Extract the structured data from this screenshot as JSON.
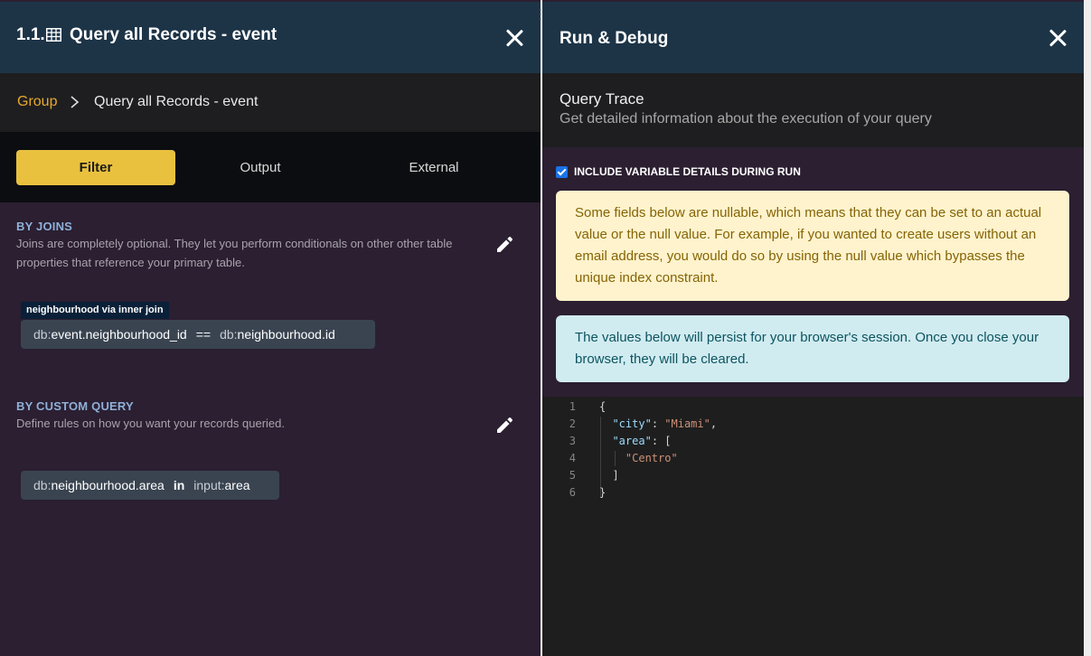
{
  "left": {
    "header": {
      "number": "1.1.",
      "title": "Query all Records - event",
      "table_icon": "table-icon",
      "close_icon": "close-icon"
    },
    "breadcrumb": {
      "group": "Group",
      "current": "Query all Records - event"
    },
    "tabs": [
      {
        "label": "Filter",
        "active": true
      },
      {
        "label": "Output"
      },
      {
        "label": "External"
      }
    ],
    "joins": {
      "heading": "BY JOINS",
      "description": "Joins are completely optional. They let you perform conditionals on other other table properties that reference your primary table.",
      "tag": "neighbourhood via inner join",
      "expr": {
        "lhs_prefix": "db:",
        "lhs": "event.neighbourhood_id",
        "op": "==",
        "rhs_prefix": "db:",
        "rhs": "neighbourhood.id"
      }
    },
    "custom": {
      "heading": "BY CUSTOM QUERY",
      "description": "Define rules on how you want your records queried.",
      "expr": {
        "lhs_prefix": "db:",
        "lhs": "neighbourhood.area",
        "op": "in",
        "rhs_prefix": "input:",
        "rhs": "area"
      }
    }
  },
  "right": {
    "header": {
      "title": "Run & Debug",
      "close_icon": "close-icon"
    },
    "trace": {
      "title": "Query Trace",
      "subtitle": "Get detailed information about the execution of your query"
    },
    "checkbox": {
      "label": "INCLUDE VARIABLE DETAILS DURING RUN",
      "checked": true
    },
    "warning": "Some fields below are nullable, which means that they can be set to an actual value or the null value. For example, if you wanted to create users without an email address, you would do so by using the null value which bypasses the unique index constraint.",
    "info": "The values below will persist for your browser's session. Once you close your browser, they will be cleared.",
    "editor": {
      "line_numbers": [
        "1",
        "2",
        "3",
        "4",
        "5",
        "6"
      ],
      "lines": [
        {
          "indent": "",
          "tokens": [
            {
              "t": "p",
              "v": "{"
            }
          ]
        },
        {
          "indent": "  ",
          "tokens": [
            {
              "t": "k",
              "v": "\"city\""
            },
            {
              "t": "p",
              "v": ": "
            },
            {
              "t": "s",
              "v": "\"Miami\""
            },
            {
              "t": "p",
              "v": ","
            }
          ]
        },
        {
          "indent": "  ",
          "tokens": [
            {
              "t": "k",
              "v": "\"area\""
            },
            {
              "t": "p",
              "v": ": ["
            }
          ]
        },
        {
          "indent": "    ",
          "tokens": [
            {
              "t": "s",
              "v": "\"Centro\""
            }
          ]
        },
        {
          "indent": "  ",
          "tokens": [
            {
              "t": "p",
              "v": "]"
            }
          ]
        },
        {
          "indent": "",
          "tokens": [
            {
              "t": "p",
              "v": "}"
            }
          ]
        }
      ]
    }
  },
  "colors": {
    "accent": "#e9c13f",
    "header_bg": "#1d3447",
    "panel_bg": "#2b1f31",
    "link_orange": "#e8a92f"
  }
}
